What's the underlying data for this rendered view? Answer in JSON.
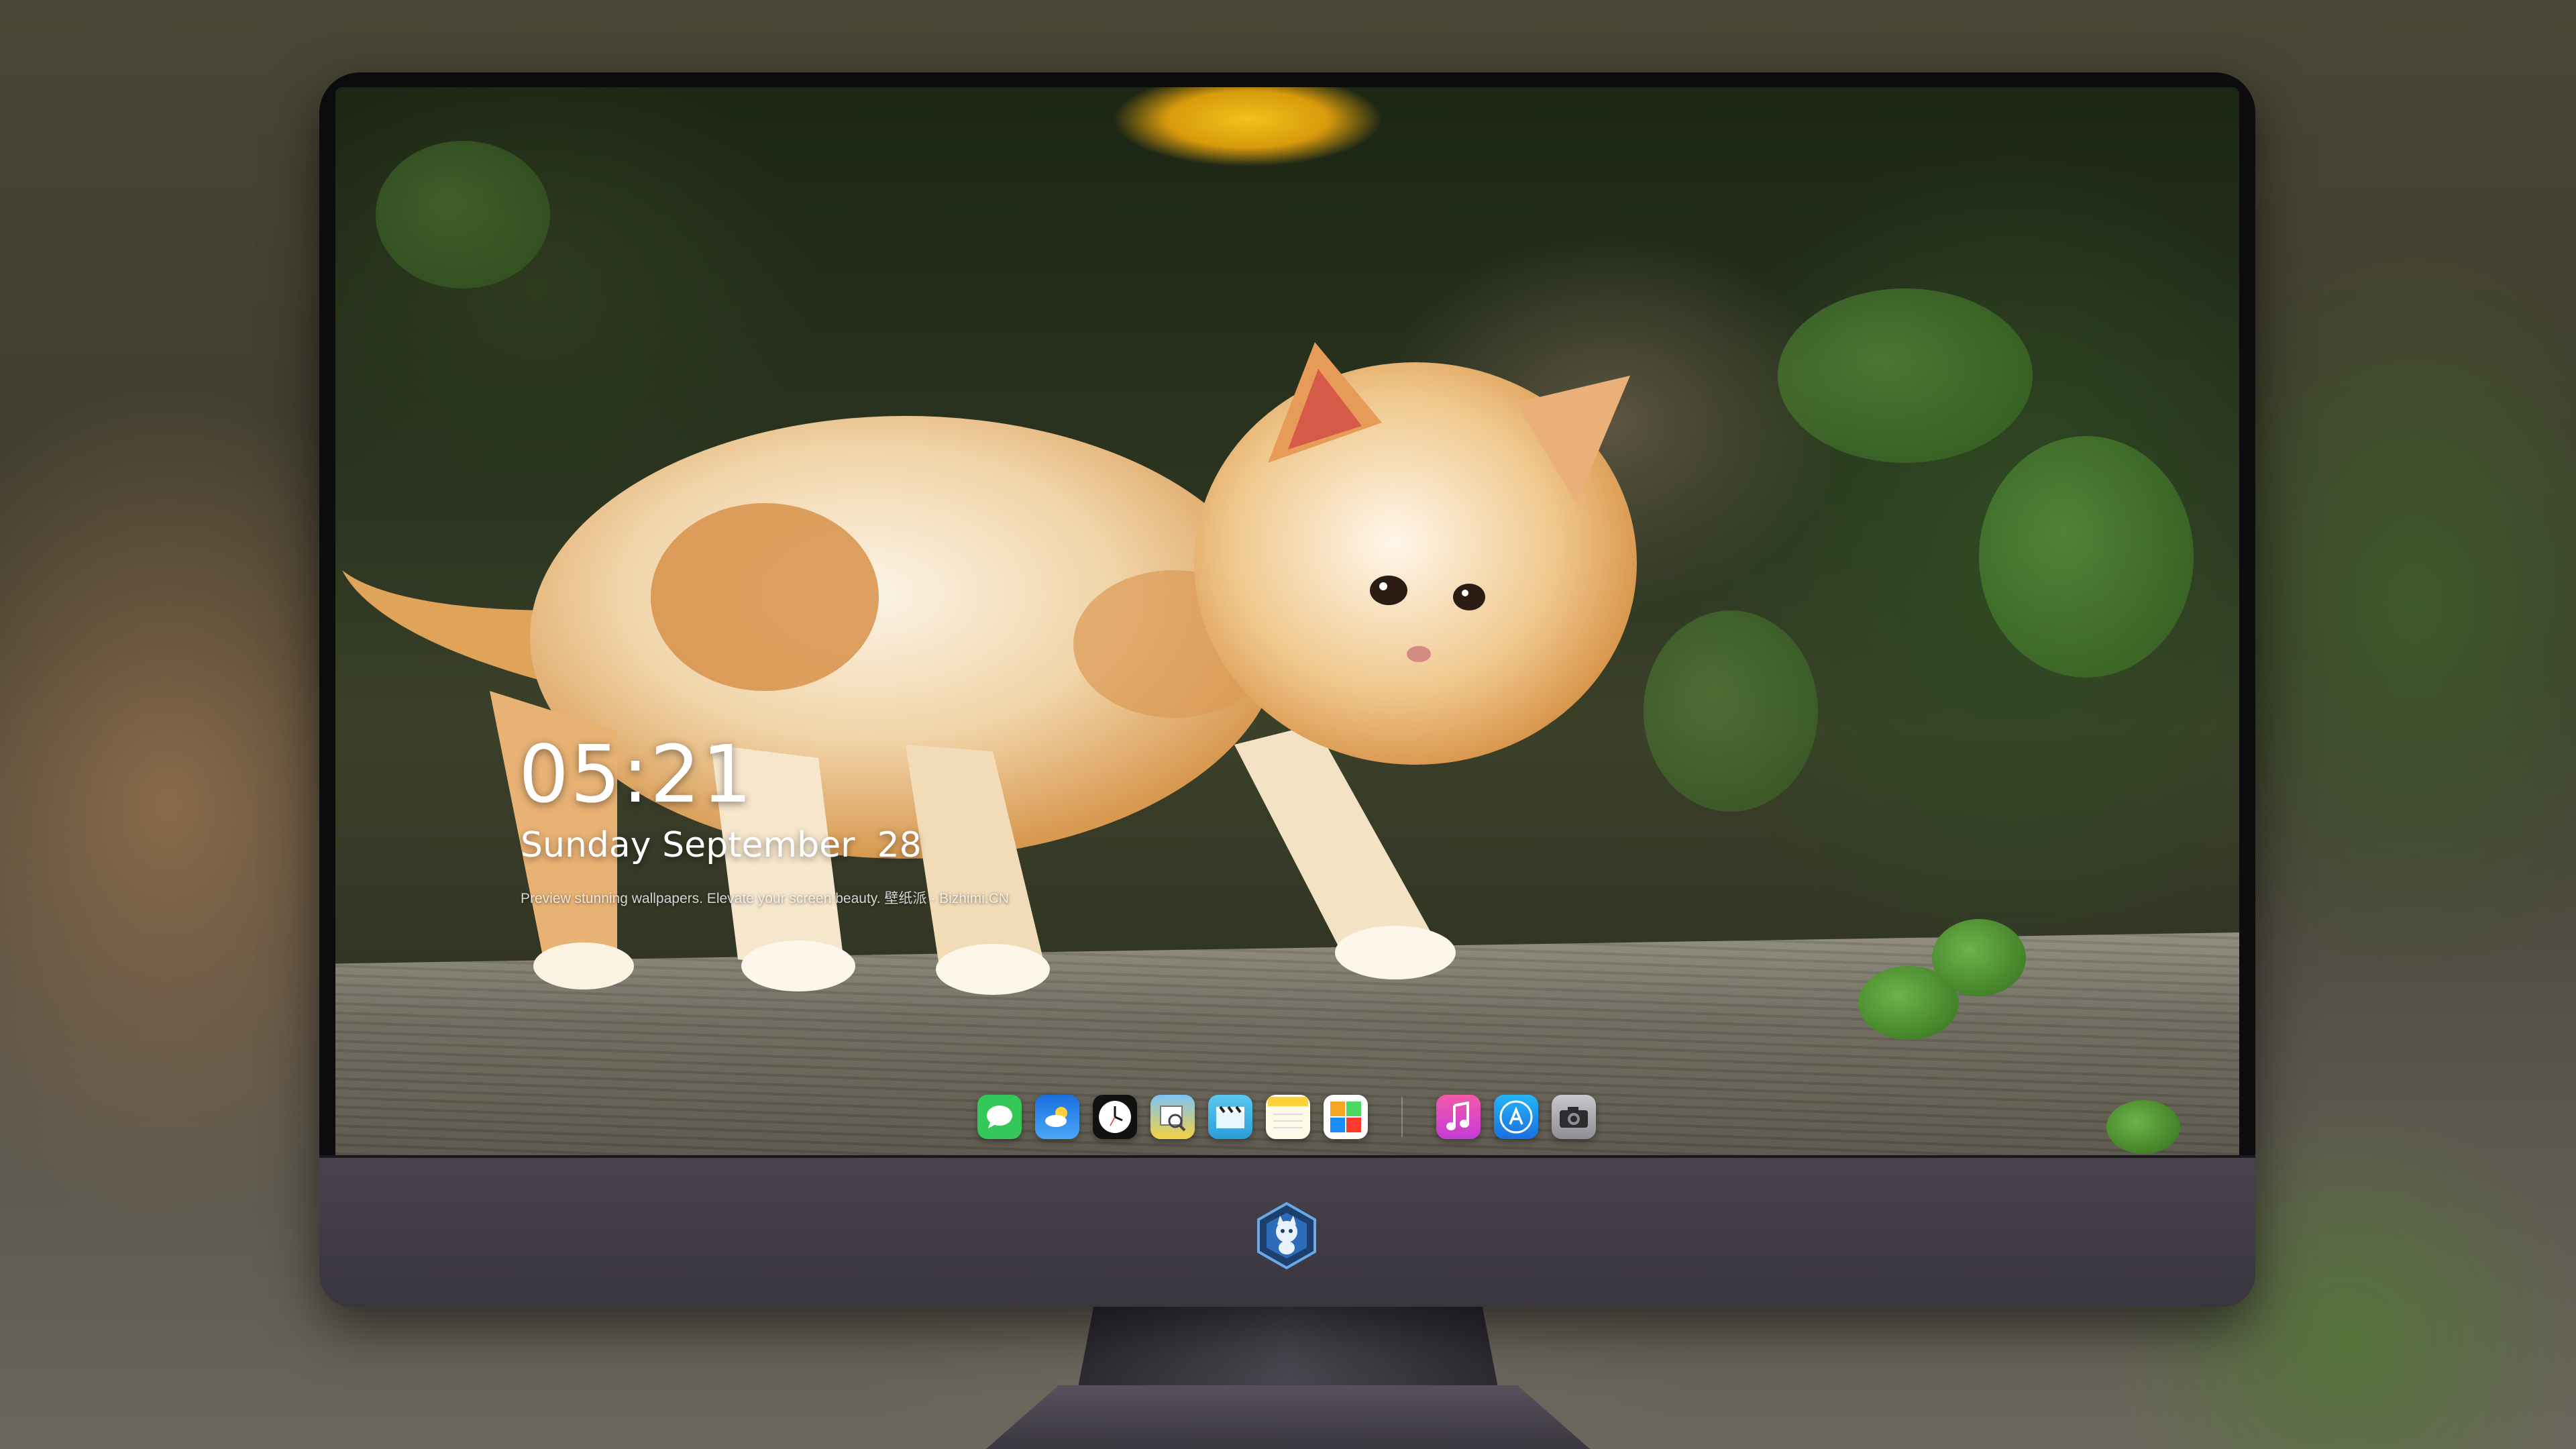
{
  "lock_screen": {
    "time": "05:21",
    "date": "Sunday September  28",
    "tagline": "Preview stunning wallpapers. Elevate your screen beauty. 壁纸派 · Bizhimi.CN"
  },
  "dock": {
    "apps": [
      {
        "name": "messages-icon",
        "color": "#34c759"
      },
      {
        "name": "weather-icon",
        "color": "#1f8bf0"
      },
      {
        "name": "clock-icon",
        "color": "#ffffff"
      },
      {
        "name": "preview-icon",
        "color": "#f5d142"
      },
      {
        "name": "video-clips-icon",
        "color": "#3ab4e8"
      },
      {
        "name": "notes-icon",
        "color": "#ffd23b"
      },
      {
        "name": "photo-collage-icon",
        "color": "#ffffff"
      },
      {
        "name": "music-icon",
        "color": "#f14fa8"
      },
      {
        "name": "app-store-icon",
        "color": "#1a8cf5"
      },
      {
        "name": "camera-icon",
        "color": "#8e8e93"
      }
    ]
  },
  "colors": {
    "monitor_body": "#0c0c0e",
    "chin": "#433f48",
    "text": "#ffffff"
  }
}
